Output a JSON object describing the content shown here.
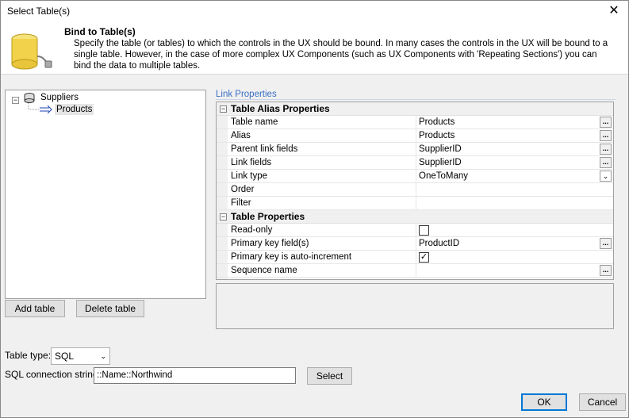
{
  "window": {
    "title": "Select Table(s)",
    "close_glyph": "✕"
  },
  "header": {
    "title": "Bind to Table(s)",
    "description": "Specify the table (or tables) to which the controls in the UX should be bound. In many cases the controls in the UX will be bound to a single table. However, in the case of more complex UX Components (such as UX Components with 'Repeating Sections') you can bind the data to multiple tables.",
    "icon": "database-icon"
  },
  "tree": {
    "root": "Suppliers",
    "child": "Products",
    "expander_glyph": "−"
  },
  "buttons": {
    "add_table": "Add table",
    "delete_table": "Delete table",
    "select": "Select",
    "ok": "OK",
    "cancel": "Cancel"
  },
  "link_properties": {
    "label": "Link Properties",
    "categories": {
      "alias": "Table Alias Properties",
      "table": "Table Properties"
    },
    "rows": [
      {
        "name": "Table name",
        "value": "Products"
      },
      {
        "name": "Alias",
        "value": "Products"
      },
      {
        "name": "Parent link fields",
        "value": "SupplierID"
      },
      {
        "name": "Link fields",
        "value": "SupplierID"
      },
      {
        "name": "Link type",
        "value": "OneToMany"
      },
      {
        "name": "Order",
        "value": ""
      },
      {
        "name": "Filter",
        "value": ""
      }
    ],
    "table_rows": [
      {
        "name": "Read-only",
        "checked": false
      },
      {
        "name": "Primary key field(s)",
        "value": "ProductID"
      },
      {
        "name": "Primary key is auto-increment",
        "checked": true
      },
      {
        "name": "Sequence name",
        "value": ""
      }
    ],
    "ellipsis": "...",
    "check_glyph": "✓",
    "dropdown_glyph": "⌄"
  },
  "bottom": {
    "table_type_label": "Table type:",
    "table_type_value": "SQL",
    "conn_label": "SQL connection string:",
    "conn_value": "::Name::Northwind"
  }
}
